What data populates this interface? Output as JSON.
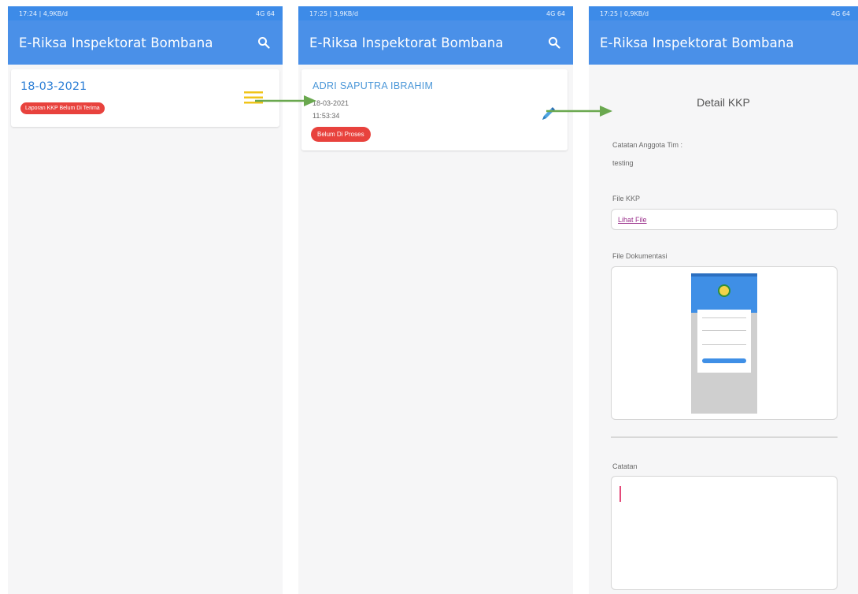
{
  "app": {
    "title": "E-Riksa Inspektorat Bombana"
  },
  "screens": [
    {
      "status_time": "17:24 | 4,9KB/d",
      "status_right": "4G 64",
      "list_item": {
        "date": "18-03-2021",
        "badge": "Laporan KKP Belum Di Terima"
      }
    },
    {
      "status_time": "17:25 | 3,9KB/d",
      "status_right": "4G 64",
      "list_item": {
        "name": "ADRI SAPUTRA IBRAHIM",
        "date": "18-03-2021",
        "time": "11:53:34",
        "badge": "Belum Di Proses"
      }
    },
    {
      "status_time": "17:25 | 0,9KB/d",
      "status_right": "4G 64",
      "detail": {
        "title": "Detail KKP",
        "catatan_anggota_label": "Catatan Anggota Tim :",
        "catatan_anggota_value": "testing",
        "file_kkp_label": "File KKP",
        "file_link": "Lihat File",
        "file_dok_label": "File Dokumentasi",
        "catatan_label": "Catatan",
        "catatan_value": ""
      }
    }
  ],
  "colors": {
    "appbar": "#4a90e8",
    "statusbar": "#3d8be8",
    "badge_red": "#e8423d",
    "arrow_green": "#6aa84f",
    "menu_yellow": "#f0c419"
  },
  "icons": [
    "search-icon",
    "menu-icon",
    "pencil-icon",
    "arrow-icon"
  ]
}
